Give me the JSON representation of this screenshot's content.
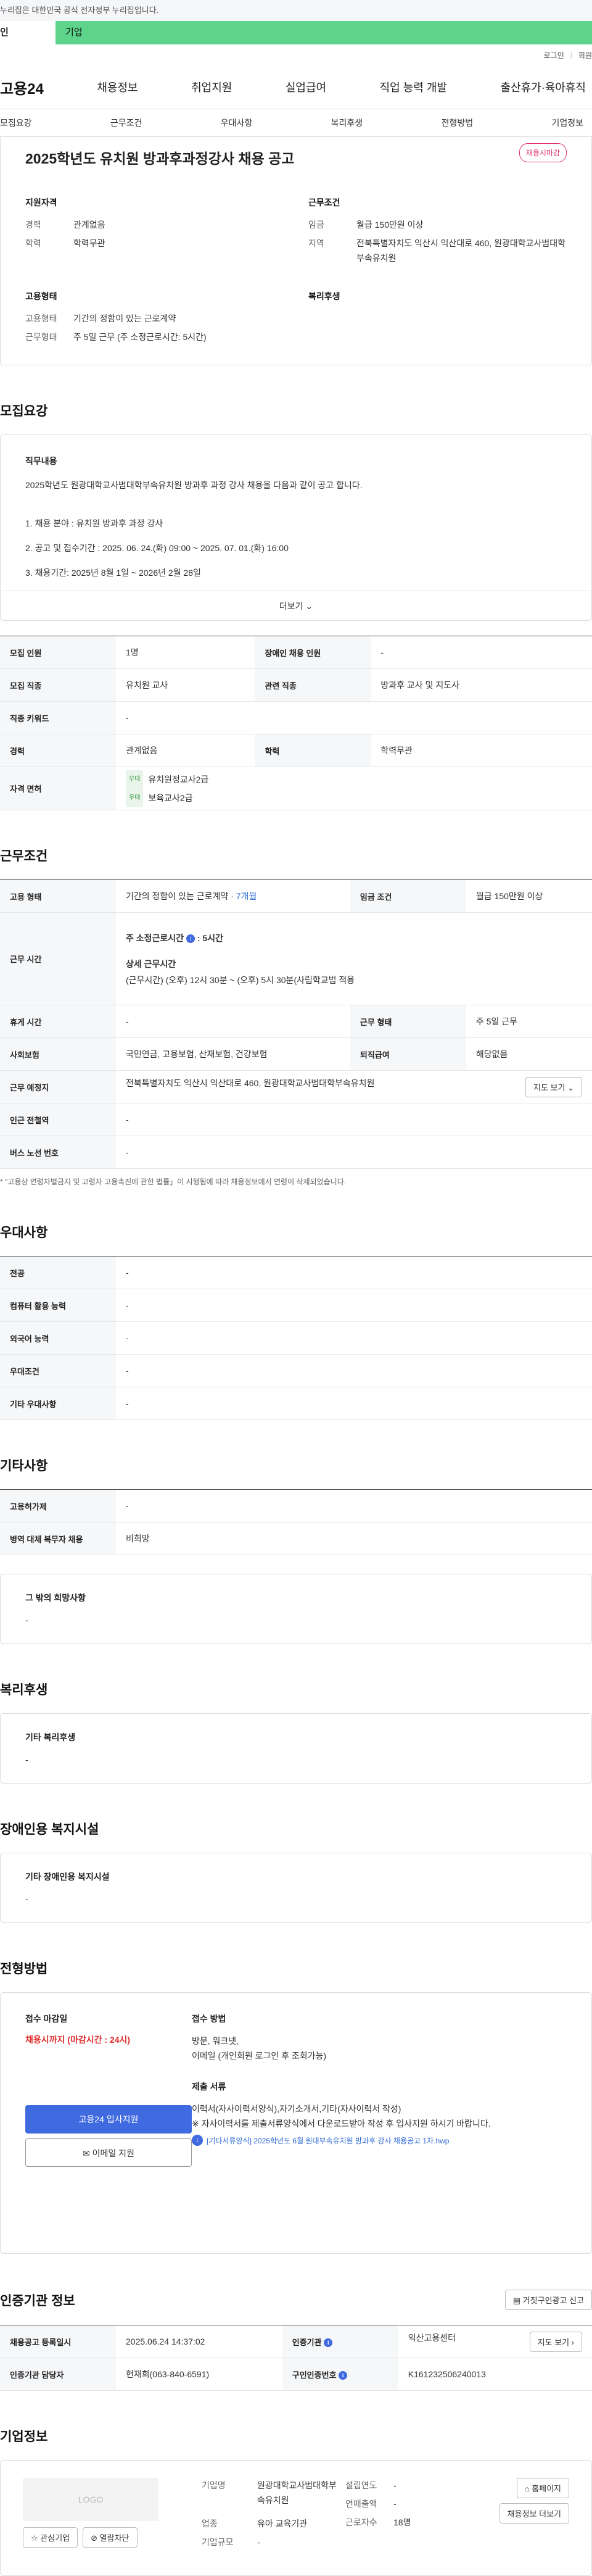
{
  "top_notice": "누리집은 대한민국 공식 전자정부 누리집입니다.",
  "user_tabs": [
    "인",
    "기업"
  ],
  "util": {
    "login": "로그인",
    "join": "회원"
  },
  "gnb": {
    "logo": "고용24",
    "menu": [
      "채용정보",
      "취업지원",
      "실업급여",
      "직업 능력 개발",
      "출산휴가·육아휴직"
    ]
  },
  "tabs": [
    "모집요강",
    "근무조건",
    "우대사항",
    "복리후생",
    "전형방법",
    "기업정보"
  ],
  "header": {
    "title": "2025학년도 유치원 방과후과정강사 채용 공고",
    "status_badge": "채용시마감",
    "qual_title": "지원자격",
    "qual": [
      {
        "k": "경력",
        "v": "관계없음"
      },
      {
        "k": "학력",
        "v": "학력무관"
      }
    ],
    "emp_title": "고용형태",
    "emp": [
      {
        "k": "고용형태",
        "v": "기간의 정함이 있는 근로계약"
      },
      {
        "k": "근무형태",
        "v": "주 5일 근무 (주 소정근로시간: 5시간)"
      }
    ],
    "cond_title": "근무조건",
    "cond": [
      {
        "k": "임금",
        "v": "월급 150만원 이상"
      },
      {
        "k": "지역",
        "v": "전북특별자치도 익산시 익산대로 460, 원광대학교사범대학부속유치원"
      }
    ],
    "welfare_title": "복리후생"
  },
  "recruit": {
    "section": "모집요강",
    "job_title": "직무내용",
    "lines": [
      "2025학년도 원광대학교사범대학부속유치원 방과후 과정 강사 채용을 다음과 같이 공고 합니다.",
      "1. 채용 분야 : 유치원 방과후 과정 강사",
      "2. 공고 및 접수기간 : 2025. 06. 24.(화) 09:00 ~ 2025. 07. 01.(화) 16:00",
      "3. 채용기간: 2025년 8월 1일 ~ 2026년 2월 28일"
    ],
    "more": "더보기",
    "table": {
      "r1": [
        "모집 인원",
        "1명",
        "장애인 채용 인원",
        "-"
      ],
      "r2": [
        "모집 직종",
        "유치원 교사",
        "관련 직종",
        "방과후 교사 및 지도사"
      ],
      "r3": [
        "직종 키워드",
        "-"
      ],
      "r4": [
        "경력",
        "관계없음",
        "학력",
        "학력무관"
      ],
      "license_label": "자격 면허",
      "licenses": [
        {
          "tag": "우대",
          "name": "유치원정교사2급"
        },
        {
          "tag": "우대",
          "name": "보육교사2급"
        }
      ]
    }
  },
  "work": {
    "section": "근무조건",
    "emp_type_label": "고용 형태",
    "emp_type": "기간의 정함이 있는 근로계약 ·",
    "emp_months": "7개월",
    "wage_label": "임금 조건",
    "wage": "월급 150만원 이상",
    "hours_label": "근무 시간",
    "hours_main": "주 소정근로시간",
    "hours_value": ": 5시간",
    "hours_detail_title": "상세 근무시간",
    "hours_detail": "(근무시간) (오후) 12시 30분 ~ (오후) 5시 30분(사립학교법 적용",
    "rest_label": "휴게 시간",
    "rest": "-",
    "form_label": "근무 형태",
    "form": "주 5일 근무",
    "insurance_label": "사회보험",
    "insurance": "국민연금, 고용보험, 산재보험, 건강보험",
    "severance_label": "퇴직급여",
    "severance": "해당없음",
    "place_label": "근무 예정지",
    "place": "전북특별자치도 익산시 익산대로 460, 원광대학교사범대학부속유치원",
    "map_btn": "지도 보기",
    "station_label": "인근 전철역",
    "station": "-",
    "bus_label": "버스 노선 번호",
    "bus": "-",
    "note": "\"고용상 연령차별금지 및 고령자 고용촉진에 관한 법률」이 시행됨에 따라 채용정보에서 연령이 삭제되었습니다."
  },
  "pref": {
    "section": "우대사항",
    "rows": [
      [
        "전공",
        "-"
      ],
      [
        "컴퓨터 활용 능력",
        "-"
      ],
      [
        "외국어 능력",
        "-"
      ],
      [
        "우대조건",
        "-"
      ],
      [
        "기타 우대사항",
        "-"
      ]
    ]
  },
  "etc": {
    "section": "기타사항",
    "rows": [
      [
        "고용허가제",
        "-"
      ],
      [
        "병역 대체 복무자 채용",
        "비희망"
      ]
    ],
    "other_title": "그 밖의 희망사항",
    "other": "-"
  },
  "welfare": {
    "section": "복리후생",
    "title": "기타 복리후생",
    "value": "-"
  },
  "disability": {
    "section": "장애인용 복지시설",
    "title": "기타 장애인용 복지시설",
    "value": "-"
  },
  "apply": {
    "section": "전형방법",
    "deadline_title": "접수 마감일",
    "deadline": "채용시까지 (마감시간 : 24시)",
    "method_title": "접수 방법",
    "method_1": "방문, 워크넷,",
    "method_2": "이메일 (개인회원 로그인 후 조회가능)",
    "docs_title": "제출 서류",
    "docs": "이력서(자사이력서양식),자기소개서,기타(자사이력서 작성)",
    "docs_note": "※ 자사이력서를 제출서류양식에서 다운로드받아 작성 후 입사지원 하시기 바랍니다.",
    "file": "[기타서류양식] 2025학년도 6월 원대부속유치원 방과후 강사 채용공고 1차.hwp",
    "apply_btn": "고용24 입사지원",
    "email_btn": "이메일 지원"
  },
  "cert": {
    "section": "인증기관 정보",
    "copy_btn": "거짓구인광고 신고",
    "reg_label": "채용공고 등록일시",
    "reg": "2025.06.24 14:37:02",
    "agency_label": "인증기관",
    "agency": "익산고용센터",
    "map_btn": "지도 보기",
    "manager_label": "인증기관 담당자",
    "manager": "현재희(063-840-6591)",
    "no_label": "구인인증번호",
    "no": "K161232506240013"
  },
  "company": {
    "section": "기업정보",
    "logo": "LOGO",
    "fav_btn": "관심기업",
    "noti_btn": "열람차단",
    "name_label": "기업명",
    "name": "원광대학교사범대학부속유치원",
    "industry_label": "업종",
    "industry": "유아 교육기관",
    "size_label": "기업규모",
    "size": "-",
    "found_label": "설립연도",
    "found": "-",
    "sales_label": "연매출액",
    "sales": "-",
    "emp_label": "근로자수",
    "emp": "18명",
    "home_btn": "홈페이지",
    "more_btn": "채용정보 더보기"
  }
}
